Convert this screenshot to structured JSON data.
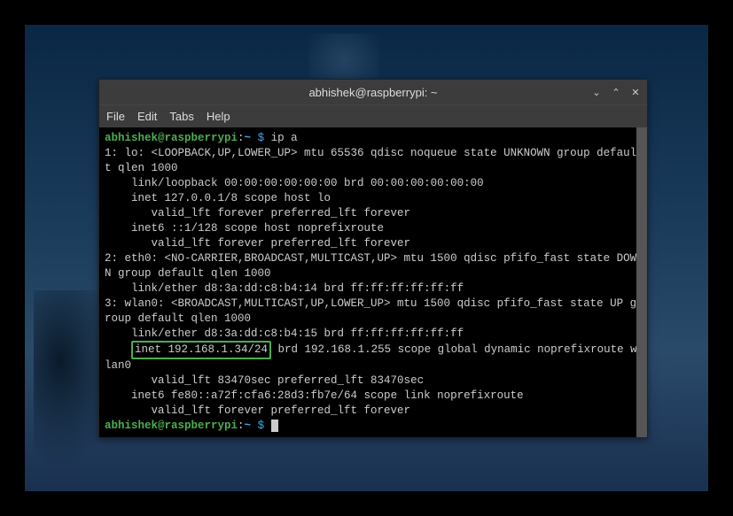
{
  "window": {
    "title": "abhishek@raspberrypi: ~"
  },
  "menubar": {
    "file": "File",
    "edit": "Edit",
    "tabs": "Tabs",
    "help": "Help"
  },
  "prompt": {
    "user_host": "abhishek@raspberrypi",
    "path": "~",
    "symbol": "$"
  },
  "command": "ip a",
  "output_lines": {
    "l1": "1: lo: <LOOPBACK,UP,LOWER_UP> mtu 65536 qdisc noqueue state UNKNOWN group default qlen 1000",
    "l2": "    link/loopback 00:00:00:00:00:00 brd 00:00:00:00:00:00",
    "l3": "    inet 127.0.0.1/8 scope host lo",
    "l4": "       valid_lft forever preferred_lft forever",
    "l5": "    inet6 ::1/128 scope host noprefixroute",
    "l6": "       valid_lft forever preferred_lft forever",
    "l7": "2: eth0: <NO-CARRIER,BROADCAST,MULTICAST,UP> mtu 1500 qdisc pfifo_fast state DOWN group default qlen 1000",
    "l8": "    link/ether d8:3a:dd:c8:b4:14 brd ff:ff:ff:ff:ff:ff",
    "l9": "3: wlan0: <BROADCAST,MULTICAST,UP,LOWER_UP> mtu 1500 qdisc pfifo_fast state UP group default qlen 1000",
    "l10": "    link/ether d8:3a:dd:c8:b4:15 brd ff:ff:ff:ff:ff:ff",
    "l11_pre": "    ",
    "l11_hl": "inet 192.168.1.34/24",
    "l11_post": " brd 192.168.1.255 scope global dynamic noprefixroute wlan0",
    "l12": "       valid_lft 83470sec preferred_lft 83470sec",
    "l13": "    inet6 fe80::a72f:cfa6:28d3:fb7e/64 scope link noprefixroute",
    "l14": "       valid_lft forever preferred_lft forever"
  }
}
